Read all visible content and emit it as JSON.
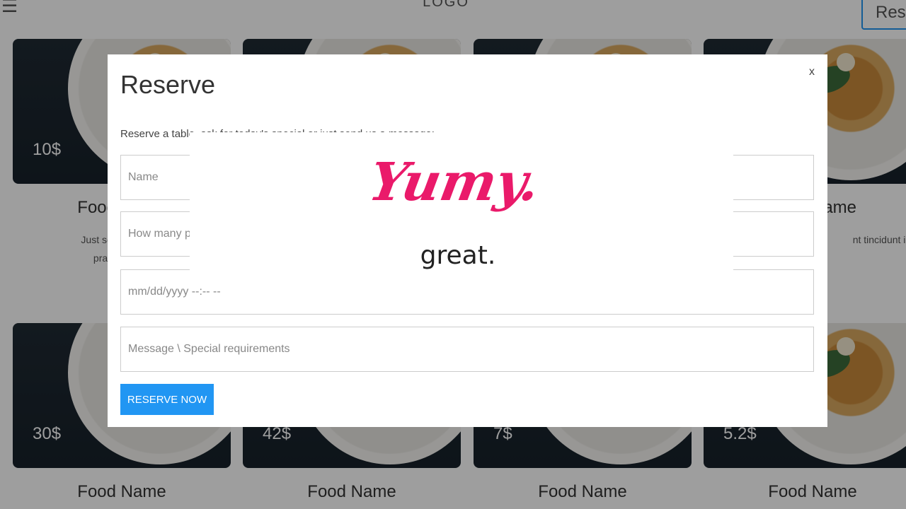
{
  "header": {
    "logo": "LOGO",
    "reserve_button": "Rese",
    "menu_icon": "menu-icon"
  },
  "cards": [
    {
      "price": "10$",
      "name": "Food Name",
      "desc_line1": "Just some random",
      "desc_line2": "praesent tinc"
    },
    {
      "price": "",
      "name": "",
      "desc_line1": "",
      "desc_line2": ""
    },
    {
      "price": "",
      "name": "",
      "desc_line1": "",
      "desc_line2": ""
    },
    {
      "price": "",
      "name": "ame",
      "desc_line1": "nt tincidunt ipsu",
      "desc_line2": ""
    },
    {
      "price": "30$",
      "name": "Food Name"
    },
    {
      "price": "42$",
      "name": "Food Name"
    },
    {
      "price": "7$",
      "name": "Food Name"
    },
    {
      "price": "5.2$",
      "name": "Food Name"
    }
  ],
  "modal": {
    "title": "Reserve",
    "close_label": "x",
    "description": "Reserve a table, ask for today's special or just send us a message:",
    "fields": {
      "name_placeholder": "Name",
      "people_placeholder": "How many people",
      "date_placeholder": "mm/dd/yyyy --:-- --",
      "message_placeholder": "Message \\ Special requirements"
    },
    "submit_label": "RESERVE NOW"
  },
  "splash": {
    "brand": "Yumy.",
    "tagline": "great."
  },
  "colors": {
    "accent": "#2196F3",
    "brand": "#ea1a6a"
  }
}
